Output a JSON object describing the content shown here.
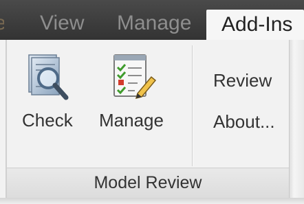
{
  "tabs": {
    "view": "View",
    "manage": "Manage",
    "addins": "Add-Ins"
  },
  "panel": {
    "title": "Model Review",
    "check": {
      "label": "Check",
      "icon": "check-magnifier-icon"
    },
    "manage": {
      "label": "Manage",
      "icon": "checklist-pencil-icon"
    },
    "review_label": "Review",
    "about_label": "About..."
  },
  "colors": {
    "tabbar": "#333333",
    "active_tab": "#f6f6f6",
    "check_green": "#3f9b2c",
    "cross_red": "#d23b2c"
  }
}
